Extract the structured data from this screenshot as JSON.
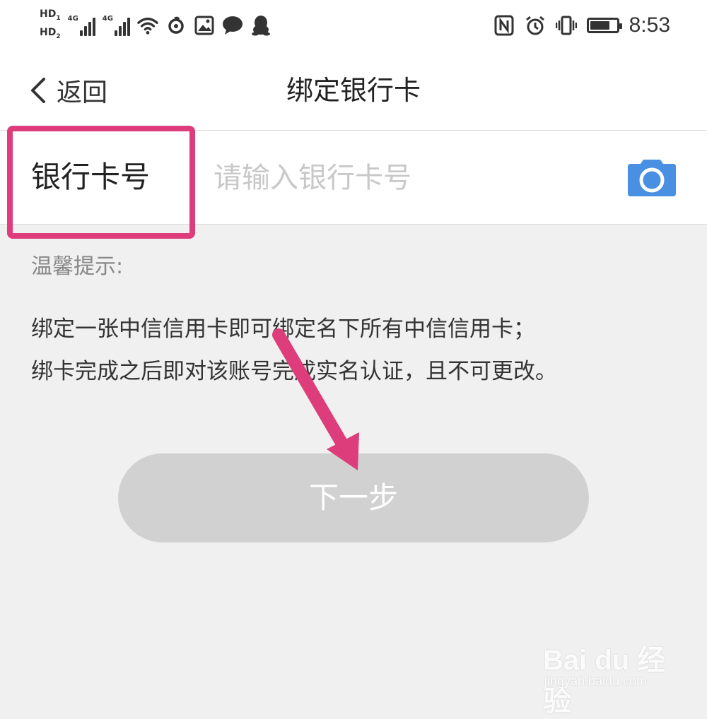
{
  "status_bar": {
    "hd1": "HD",
    "hd1_sub": "1",
    "hd2": "HD",
    "hd2_sub": "2",
    "sig1_label": "4G",
    "sig2_label": "4G",
    "time": "8:53",
    "battery_level": 0.75,
    "icons": [
      "hd-icon",
      "signal-icon",
      "signal-icon",
      "wifi-icon",
      "netease-music-icon",
      "image-icon",
      "chat-bubble-icon",
      "qq-penguin-icon",
      "nfc-icon",
      "alarm-icon",
      "vibrate-icon",
      "battery-icon"
    ]
  },
  "navbar": {
    "back_label": "返回",
    "title": "绑定银行卡"
  },
  "card_field": {
    "label": "银行卡号",
    "placeholder": "请输入银行卡号",
    "value": "",
    "camera_icon": "camera-icon"
  },
  "tips": {
    "title": "温馨提示:",
    "lines": [
      "绑定一张中信信用卡即可绑定名下所有中信信用卡；",
      "绑卡完成之后即对该账号完成实名认证，且不可更改。"
    ]
  },
  "next_button": {
    "label": "下一步"
  },
  "annotation": {
    "color": "#dd3d7a"
  },
  "watermark": {
    "logo": "Bai  du 经验",
    "url": "jingyan.baidu.com"
  },
  "colors": {
    "accent": "#4a90e2",
    "button_disabled": "#d1d1d1",
    "highlight": "#dd3d7a",
    "background": "#f0f0f0"
  }
}
